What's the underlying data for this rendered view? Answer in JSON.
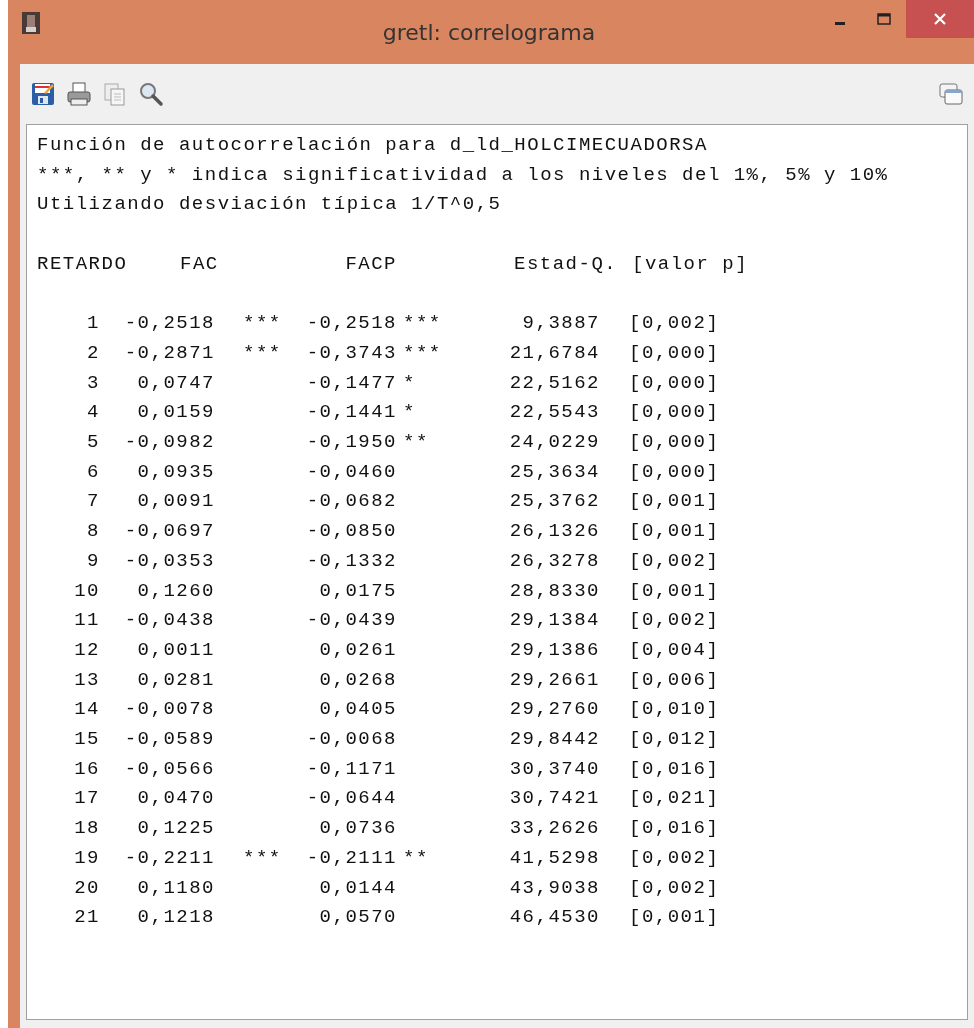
{
  "window": {
    "title": "gretl: correlograma"
  },
  "intro_lines": [
    "Función de autocorrelación para d_ld_HOLCIMECUADORSA",
    "***, ** y * indica significatividad a los niveles del 1%, 5% y 10%",
    "Utilizando desviación típica 1/T^0,5"
  ],
  "columns": [
    "RETARDO",
    "FAC",
    "FACP",
    "Estad-Q.",
    "[valor p]"
  ],
  "rows": [
    {
      "lag": "1",
      "fac": "-0,2518",
      "fac_stars": "***",
      "facp": "-0,2518",
      "facp_stars": "***",
      "q": "9,3887",
      "p": "[0,002]"
    },
    {
      "lag": "2",
      "fac": "-0,2871",
      "fac_stars": "***",
      "facp": "-0,3743",
      "facp_stars": "***",
      "q": "21,6784",
      "p": "[0,000]"
    },
    {
      "lag": "3",
      "fac": "0,0747",
      "facp": "-0,1477",
      "facp_stars": "*",
      "q": "22,5162",
      "p": "[0,000]"
    },
    {
      "lag": "4",
      "fac": "0,0159",
      "facp": "-0,1441",
      "facp_stars": "*",
      "q": "22,5543",
      "p": "[0,000]"
    },
    {
      "lag": "5",
      "fac": "-0,0982",
      "facp": "-0,1950",
      "facp_stars": "**",
      "q": "24,0229",
      "p": "[0,000]"
    },
    {
      "lag": "6",
      "fac": "0,0935",
      "facp": "-0,0460",
      "q": "25,3634",
      "p": "[0,000]"
    },
    {
      "lag": "7",
      "fac": "0,0091",
      "facp": "-0,0682",
      "q": "25,3762",
      "p": "[0,001]"
    },
    {
      "lag": "8",
      "fac": "-0,0697",
      "facp": "-0,0850",
      "q": "26,1326",
      "p": "[0,001]"
    },
    {
      "lag": "9",
      "fac": "-0,0353",
      "facp": "-0,1332",
      "q": "26,3278",
      "p": "[0,002]"
    },
    {
      "lag": "10",
      "fac": "0,1260",
      "facp": "0,0175",
      "q": "28,8330",
      "p": "[0,001]"
    },
    {
      "lag": "11",
      "fac": "-0,0438",
      "facp": "-0,0439",
      "q": "29,1384",
      "p": "[0,002]"
    },
    {
      "lag": "12",
      "fac": "0,0011",
      "facp": "0,0261",
      "q": "29,1386",
      "p": "[0,004]"
    },
    {
      "lag": "13",
      "fac": "0,0281",
      "facp": "0,0268",
      "q": "29,2661",
      "p": "[0,006]"
    },
    {
      "lag": "14",
      "fac": "-0,0078",
      "facp": "0,0405",
      "q": "29,2760",
      "p": "[0,010]"
    },
    {
      "lag": "15",
      "fac": "-0,0589",
      "facp": "-0,0068",
      "q": "29,8442",
      "p": "[0,012]"
    },
    {
      "lag": "16",
      "fac": "-0,0566",
      "facp": "-0,1171",
      "q": "30,3740",
      "p": "[0,016]"
    },
    {
      "lag": "17",
      "fac": "0,0470",
      "facp": "-0,0644",
      "q": "30,7421",
      "p": "[0,021]"
    },
    {
      "lag": "18",
      "fac": "0,1225",
      "facp": "0,0736",
      "q": "33,2626",
      "p": "[0,016]"
    },
    {
      "lag": "19",
      "fac": "-0,2211",
      "fac_stars": "***",
      "facp": "-0,2111",
      "facp_stars": "**",
      "q": "41,5298",
      "p": "[0,002]"
    },
    {
      "lag": "20",
      "fac": "0,1180",
      "facp": "0,0144",
      "q": "43,9038",
      "p": "[0,002]"
    },
    {
      "lag": "21",
      "fac": "0,1218",
      "facp": "0,0570",
      "q": "46,4530",
      "p": "[0,001]"
    }
  ]
}
